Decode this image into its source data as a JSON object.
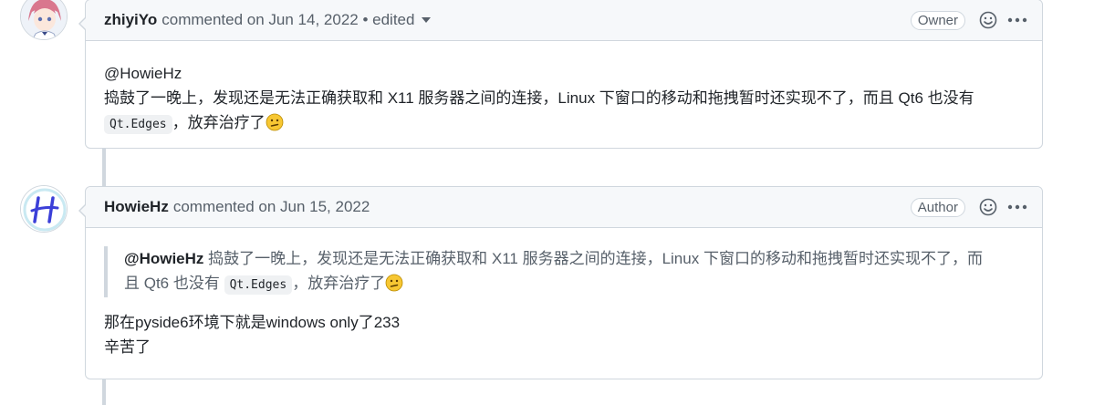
{
  "comments": [
    {
      "author": "zhiyiYo",
      "meta": "commented on Jun 14, 2022 • edited",
      "role": "Owner",
      "body": {
        "line1": "@HowieHz",
        "line2": "捣鼓了一晚上，发现还是无法正确获取和 X11 服务器之间的连接，Linux 下窗口的移动和拖拽暂时还实现不了，而且 Qt6 也没有",
        "code": "Qt.Edges",
        "line3": "，放弃治疗了"
      },
      "emoji": "confused-face-icon"
    },
    {
      "author": "HowieHz",
      "meta": "commented on Jun 15, 2022",
      "role": "Author",
      "quote": {
        "mention": "@HowieHz",
        "text1": " 捣鼓了一晚上，发现还是无法正确获取和 X11 服务器之间的连接，Linux 下窗口的移动和拖拽暂时还实现不了，而",
        "text2": "且 Qt6 也没有 ",
        "code": "Qt.Edges",
        "text3": "，放弃治疗了"
      },
      "body": {
        "line1": "那在pyside6环境下就是windows only了233",
        "line2": "辛苦了"
      }
    }
  ],
  "icons": {
    "reaction": "smiley-icon",
    "menu": "kebab-horizontal-icon"
  },
  "colors": {
    "border": "#d0d7de",
    "header_bg": "#f6f8fa",
    "muted": "#57606a",
    "avatar2_accent": "#3b3fd8"
  }
}
